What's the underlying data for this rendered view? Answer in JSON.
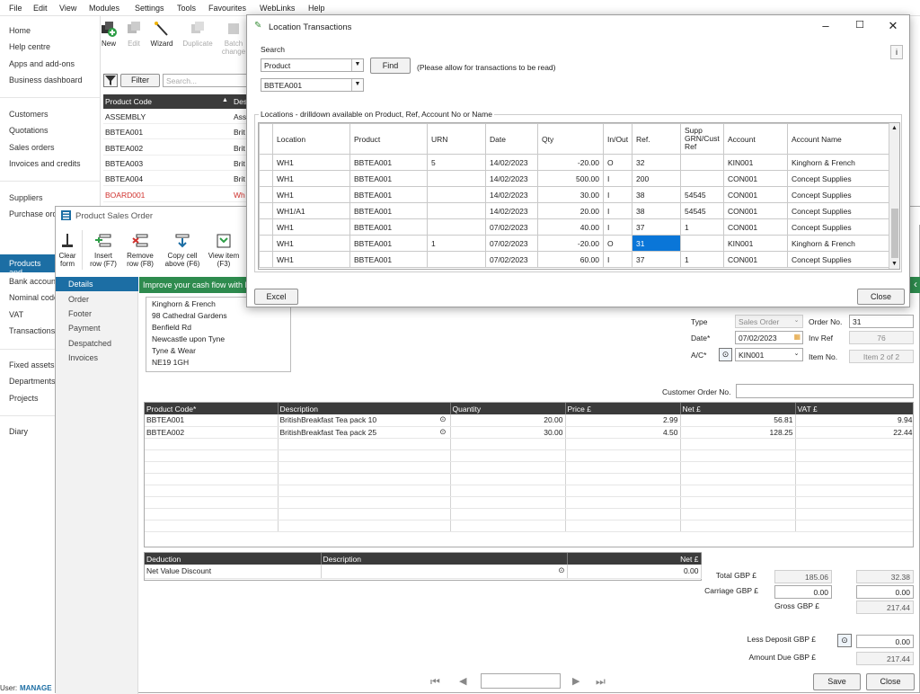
{
  "menu": [
    "File",
    "Edit",
    "View",
    "Modules",
    "Settings",
    "Tools",
    "Favourites",
    "WebLinks",
    "Help"
  ],
  "nav": {
    "group1": [
      "Home",
      "Help centre",
      "Apps and add-ons",
      "Business dashboard"
    ],
    "group2": [
      "Customers",
      "Quotations",
      "Sales orders",
      "Invoices and credits"
    ],
    "group3": [
      "Suppliers",
      "Purchase ord"
    ],
    "selected": "Products and",
    "group4": [
      "Bank accoun",
      "Nominal code",
      "VAT",
      "Transactions"
    ],
    "group5": [
      "Fixed assets",
      "Departments",
      "Projects"
    ],
    "group6": [
      "Diary"
    ],
    "user_label": "User:",
    "user_name": "MANAGE"
  },
  "toolbar": {
    "new": "New",
    "edit": "Edit",
    "wizard": "Wizard",
    "duplicate": "Duplicate",
    "batch1": "Batch",
    "batch2": "change"
  },
  "products": {
    "filter": "Filter",
    "search_placeholder": "Search...",
    "col_code": "Product Code",
    "col_desc": "Des",
    "rows": [
      {
        "code": "ASSEMBLY",
        "desc": "Ass",
        "red": false
      },
      {
        "code": "BBTEA001",
        "desc": "Brit",
        "red": false
      },
      {
        "code": "BBTEA002",
        "desc": "Brit",
        "red": false
      },
      {
        "code": "BBTEA003",
        "desc": "Brit",
        "red": false
      },
      {
        "code": "BBTEA004",
        "desc": "Brit",
        "red": false
      },
      {
        "code": "BOARD001",
        "desc": "Wh",
        "red": true
      }
    ]
  },
  "loc": {
    "title": "Location Transactions",
    "search_label": "Search",
    "search_type": "Product",
    "find": "Find",
    "note": "(Please allow for transactions to be read)",
    "product": "BBTEA001",
    "group_label": "Locations - drilldown available on Product, Ref, Account No or Name",
    "columns": [
      "Location",
      "Product",
      "URN",
      "Date",
      "Qty",
      "In/Out",
      "Ref.",
      "Supp GRN/Cust Ref",
      "Account",
      "Account Name"
    ],
    "rows": [
      [
        "WH1",
        "BBTEA001",
        "5",
        "14/02/2023",
        "-20.00",
        "O",
        "32",
        "",
        "KIN001",
        "Kinghorn & French"
      ],
      [
        "WH1",
        "BBTEA001",
        "",
        "14/02/2023",
        "500.00",
        "I",
        "200",
        "",
        "CON001",
        "Concept Supplies"
      ],
      [
        "WH1",
        "BBTEA001",
        "",
        "14/02/2023",
        "30.00",
        "I",
        "38",
        "54545",
        "CON001",
        "Concept Supplies"
      ],
      [
        "WH1/A1",
        "BBTEA001",
        "",
        "14/02/2023",
        "20.00",
        "I",
        "38",
        "54545",
        "CON001",
        "Concept Supplies"
      ],
      [
        "WH1",
        "BBTEA001",
        "",
        "07/02/2023",
        "40.00",
        "I",
        "37",
        "1",
        "CON001",
        "Concept Supplies"
      ],
      [
        "WH1",
        "BBTEA001",
        "1",
        "07/02/2023",
        "-20.00",
        "O",
        "31",
        "",
        "KIN001",
        "Kinghorn & French"
      ],
      [
        "WH1",
        "BBTEA001",
        "",
        "07/02/2023",
        "60.00",
        "I",
        "37",
        "1",
        "CON001",
        "Concept Supplies"
      ]
    ],
    "excel": "Excel",
    "close": "Close"
  },
  "order": {
    "title": "Product Sales Order",
    "tb": {
      "clear1": "Clear",
      "clear2": "form",
      "insert1": "Insert",
      "insert2": "row (F7)",
      "remove1": "Remove",
      "remove2": "row (F8)",
      "copy1": "Copy cell",
      "copy2": "above (F6)",
      "view1": "View item",
      "view2": "(F3)"
    },
    "tabs": [
      "Details",
      "Order",
      "Footer",
      "Payment",
      "Despatched",
      "Invoices"
    ],
    "banner": "Improve your cash flow with D",
    "address": [
      "Kinghorn & French",
      "98 Cathedral Gardens",
      "Benfield Rd",
      "Newcastle upon Tyne",
      "Tyne & Wear",
      "NE19 1GH"
    ],
    "type_label": "Type",
    "type_value": "Sales Order",
    "orderno_label": "Order No.",
    "orderno": "31",
    "date_label": "Date*",
    "date": "07/02/2023",
    "invref_label": "Inv Ref",
    "invref": "76",
    "ac_label": "A/C*",
    "ac": "KIN001",
    "itemno_label": "Item No.",
    "itemno": "Item 2 of 2",
    "custorder_label": "Customer Order No.",
    "cols": [
      "Product Code*",
      "Description",
      "Quantity",
      "Price £",
      "Net £",
      "VAT £"
    ],
    "lines": [
      [
        "BBTEA001",
        "BritishBreakfast  Tea pack 10",
        "20.00",
        "2.99",
        "56.81",
        "9.94"
      ],
      [
        "BBTEA002",
        "BritishBreakfast  Tea pack 25",
        "30.00",
        "4.50",
        "128.25",
        "22.44"
      ]
    ],
    "ded_cols": [
      "Deduction",
      "Description",
      "Net £"
    ],
    "ded_row": [
      "Net Value Discount",
      "",
      "0.00"
    ],
    "total_label": "Total GBP £",
    "total_net": "185.06",
    "total_vat": "32.38",
    "carriage_label": "Carriage GBP £",
    "carriage_net": "0.00",
    "carriage_vat": "0.00",
    "gross_label": "Gross GBP £",
    "gross": "217.44",
    "deposit_label": "Less Deposit GBP £",
    "deposit": "0.00",
    "due_label": "Amount Due GBP £",
    "due": "217.44",
    "save": "Save",
    "close": "Close"
  }
}
